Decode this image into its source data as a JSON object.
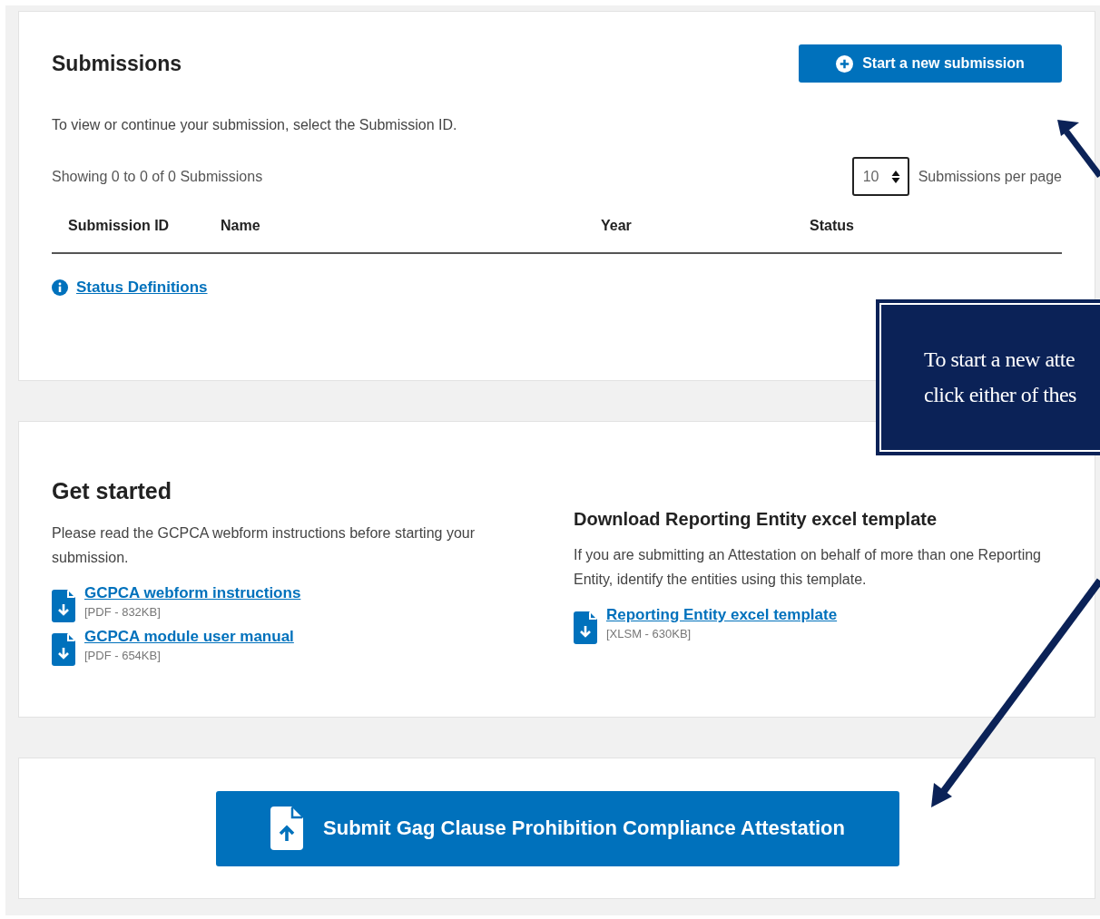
{
  "submissions": {
    "title": "Submissions",
    "new_button": "Start a new submission",
    "description": "To view or continue your submission, select the Submission ID.",
    "showing": "Showing 0 to 0 of 0 Submissions",
    "per_page": {
      "value": "10",
      "label": "Submissions per page"
    },
    "columns": [
      "Submission ID",
      "Name",
      "Year",
      "Status"
    ],
    "status_link": "Status Definitions"
  },
  "get_started": {
    "title": "Get started",
    "description": "Please read the GCPCA webform instructions before starting your submission.",
    "links": [
      {
        "label": "GCPCA webform instructions",
        "meta": "[PDF - 832KB]"
      },
      {
        "label": "GCPCA module user manual",
        "meta": "[PDF - 654KB]"
      }
    ]
  },
  "template": {
    "title": "Download Reporting Entity excel template",
    "description": "If you are submitting an Attestation on behalf of more than one Reporting Entity, identify the entities using this template.",
    "links": [
      {
        "label": "Reporting Entity excel template",
        "meta": "[XLSM - 630KB]"
      }
    ]
  },
  "submit_button": "Submit Gag Clause Prohibition Compliance Attestation",
  "callout": {
    "lines": [
      "To start a new atte",
      "click either of thes"
    ]
  }
}
